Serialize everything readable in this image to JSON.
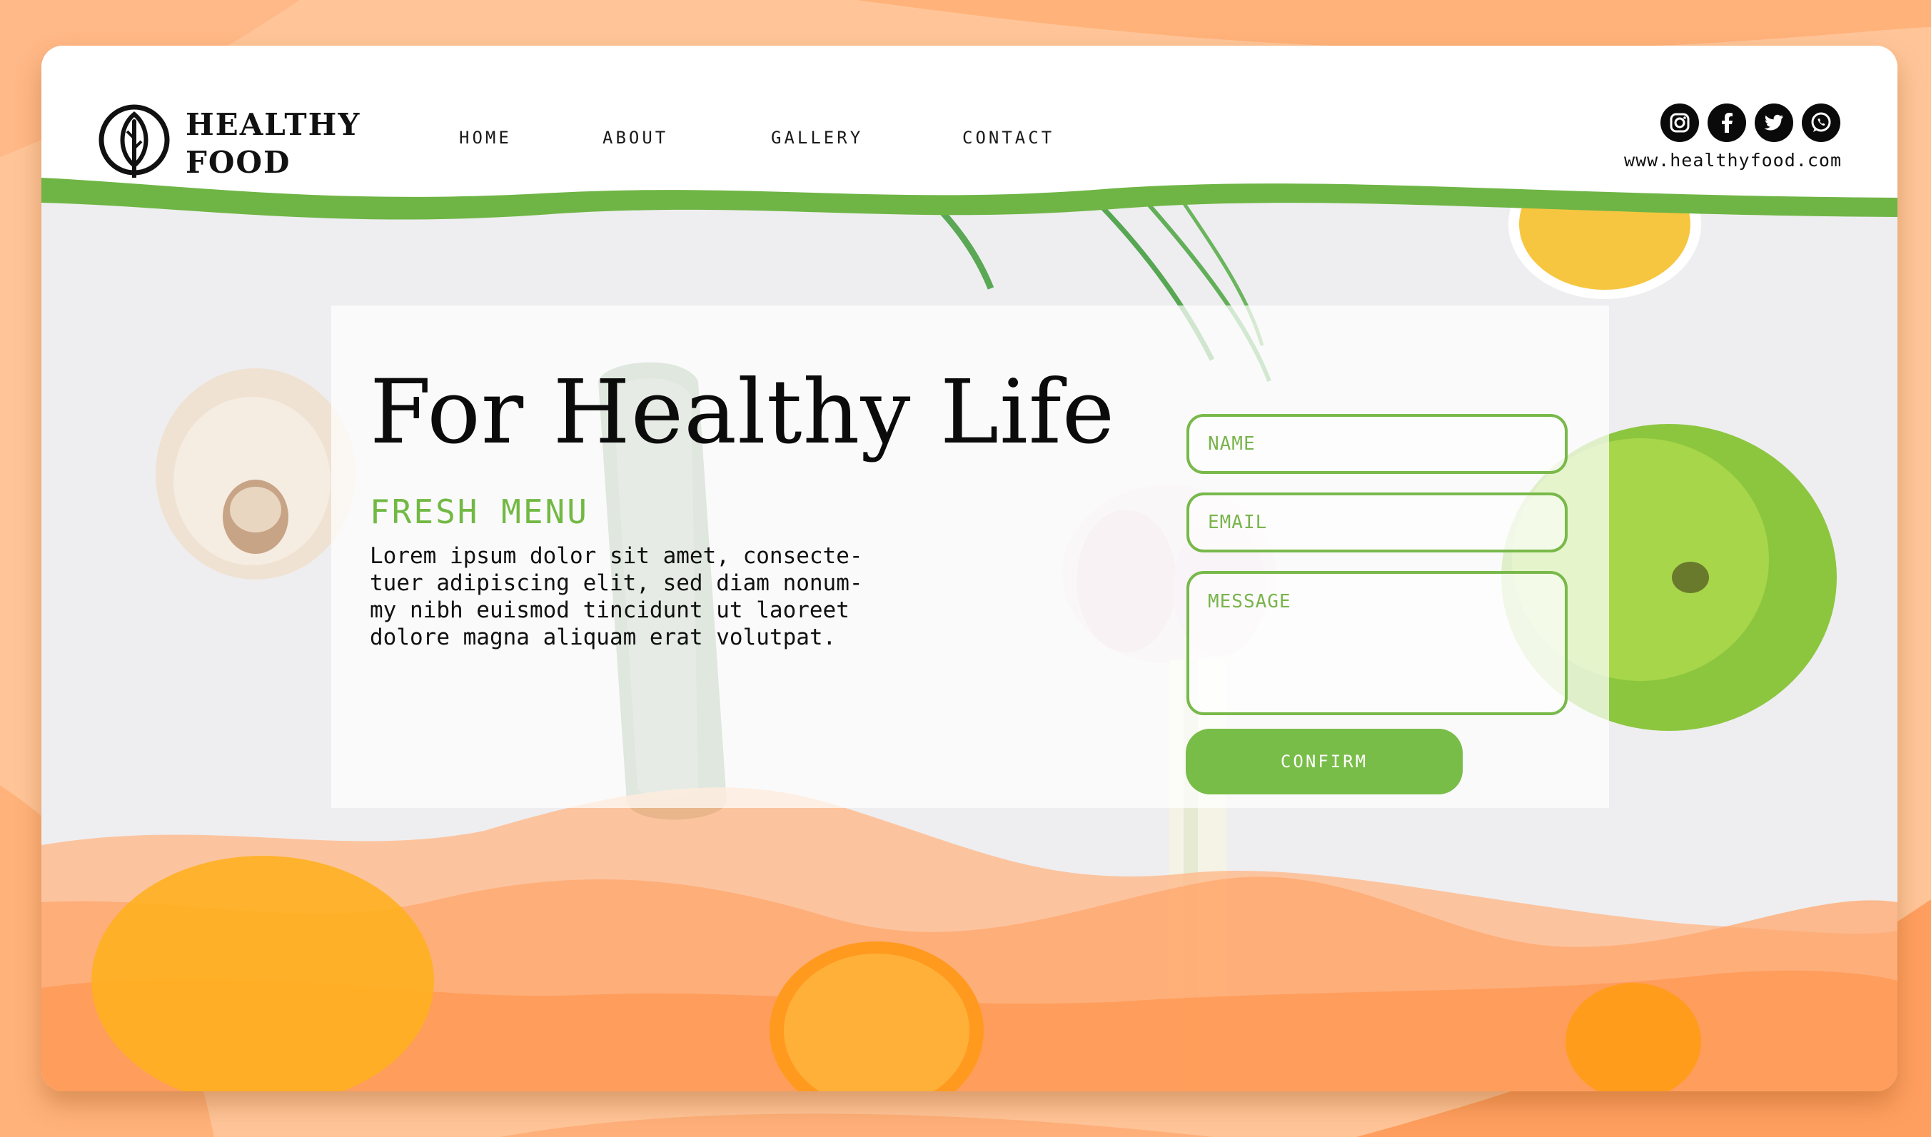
{
  "brand": {
    "name_line_1": "HEALTHY",
    "name_line_2": "FOOD",
    "icon": "leaf-icon"
  },
  "nav": {
    "items": [
      {
        "label": "HOME"
      },
      {
        "label": "ABOUT"
      },
      {
        "label": "GALLERY"
      },
      {
        "label": "CONTACT"
      }
    ]
  },
  "social": {
    "icons": [
      "instagram-icon",
      "facebook-icon",
      "twitter-icon",
      "whatsapp-icon"
    ],
    "url": "www.healthyfood.com"
  },
  "hero": {
    "title": "For Healthy Life",
    "subtitle": "FRESH MENU",
    "body_lines": [
      "Lorem ipsum dolor sit amet, consecte-",
      "tuer adipiscing elit, sed diam nonum-",
      "my nibh euismod tincidunt ut laoreet",
      "dolore magna aliquam erat volutpat."
    ]
  },
  "form": {
    "name_placeholder": "NAME",
    "email_placeholder": "EMAIL",
    "message_placeholder": "MESSAGE",
    "confirm_label": "CONFIRM"
  },
  "colors": {
    "accent_green": "#78b94a",
    "orange_background": "#ffc598",
    "text_dark": "#111111"
  }
}
